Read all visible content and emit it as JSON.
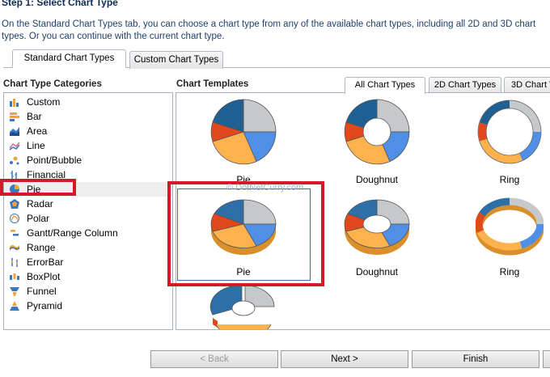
{
  "header": {
    "step_title": "Step 1: Select Chart Type",
    "intro_text": "On the Standard Chart Types tab, you can choose a chart type from any of the available chart types, including all 2D and 3D chart types. Or you can continue with the current chart type."
  },
  "outer_tabs": [
    {
      "label": "Standard Chart Types",
      "active": true
    },
    {
      "label": "Custom Chart Types",
      "active": false
    }
  ],
  "categories_label": "Chart Type Categories",
  "templates_label": "Chart Templates",
  "inner_tabs": [
    {
      "label": "All Chart Types",
      "active": true
    },
    {
      "label": "2D Chart Types",
      "active": false
    },
    {
      "label": "3D Chart T",
      "active": false
    }
  ],
  "categories": [
    {
      "label": "Custom",
      "icon": "custom-chart-icon"
    },
    {
      "label": "Bar",
      "icon": "bar-chart-icon"
    },
    {
      "label": "Area",
      "icon": "area-chart-icon"
    },
    {
      "label": "Line",
      "icon": "line-chart-icon"
    },
    {
      "label": "Point/Bubble",
      "icon": "point-bubble-icon"
    },
    {
      "label": "Financial",
      "icon": "financial-chart-icon"
    },
    {
      "label": "Pie",
      "icon": "pie-chart-icon",
      "selected": true
    },
    {
      "label": "Radar",
      "icon": "radar-chart-icon"
    },
    {
      "label": "Polar",
      "icon": "polar-chart-icon"
    },
    {
      "label": "Gantt/Range Column",
      "icon": "gantt-chart-icon"
    },
    {
      "label": "Range",
      "icon": "range-chart-icon"
    },
    {
      "label": "ErrorBar",
      "icon": "errorbar-chart-icon"
    },
    {
      "label": "BoxPlot",
      "icon": "boxplot-chart-icon"
    },
    {
      "label": "Funnel",
      "icon": "funnel-chart-icon"
    },
    {
      "label": "Pyramid",
      "icon": "pyramid-chart-icon"
    }
  ],
  "templates": [
    {
      "label": "Pie"
    },
    {
      "label": "Doughnut"
    },
    {
      "label": "Ring"
    },
    {
      "label": "Pie",
      "selected": true
    },
    {
      "label": "Doughnut"
    },
    {
      "label": "Ring"
    }
  ],
  "watermark": "© DotNetCurry.com",
  "buttons": {
    "back": "< Back",
    "next": "Next >",
    "finish": "Finish"
  },
  "colors": {
    "highlight": "#d7182a",
    "selection_border": "#3a6ab4",
    "pie_blue": "#2e6fa8",
    "pie_gray": "#c6c8cc",
    "pie_light_blue": "#4f8fe6",
    "pie_orange": "#fdb24d",
    "pie_red": "#e1481c"
  }
}
